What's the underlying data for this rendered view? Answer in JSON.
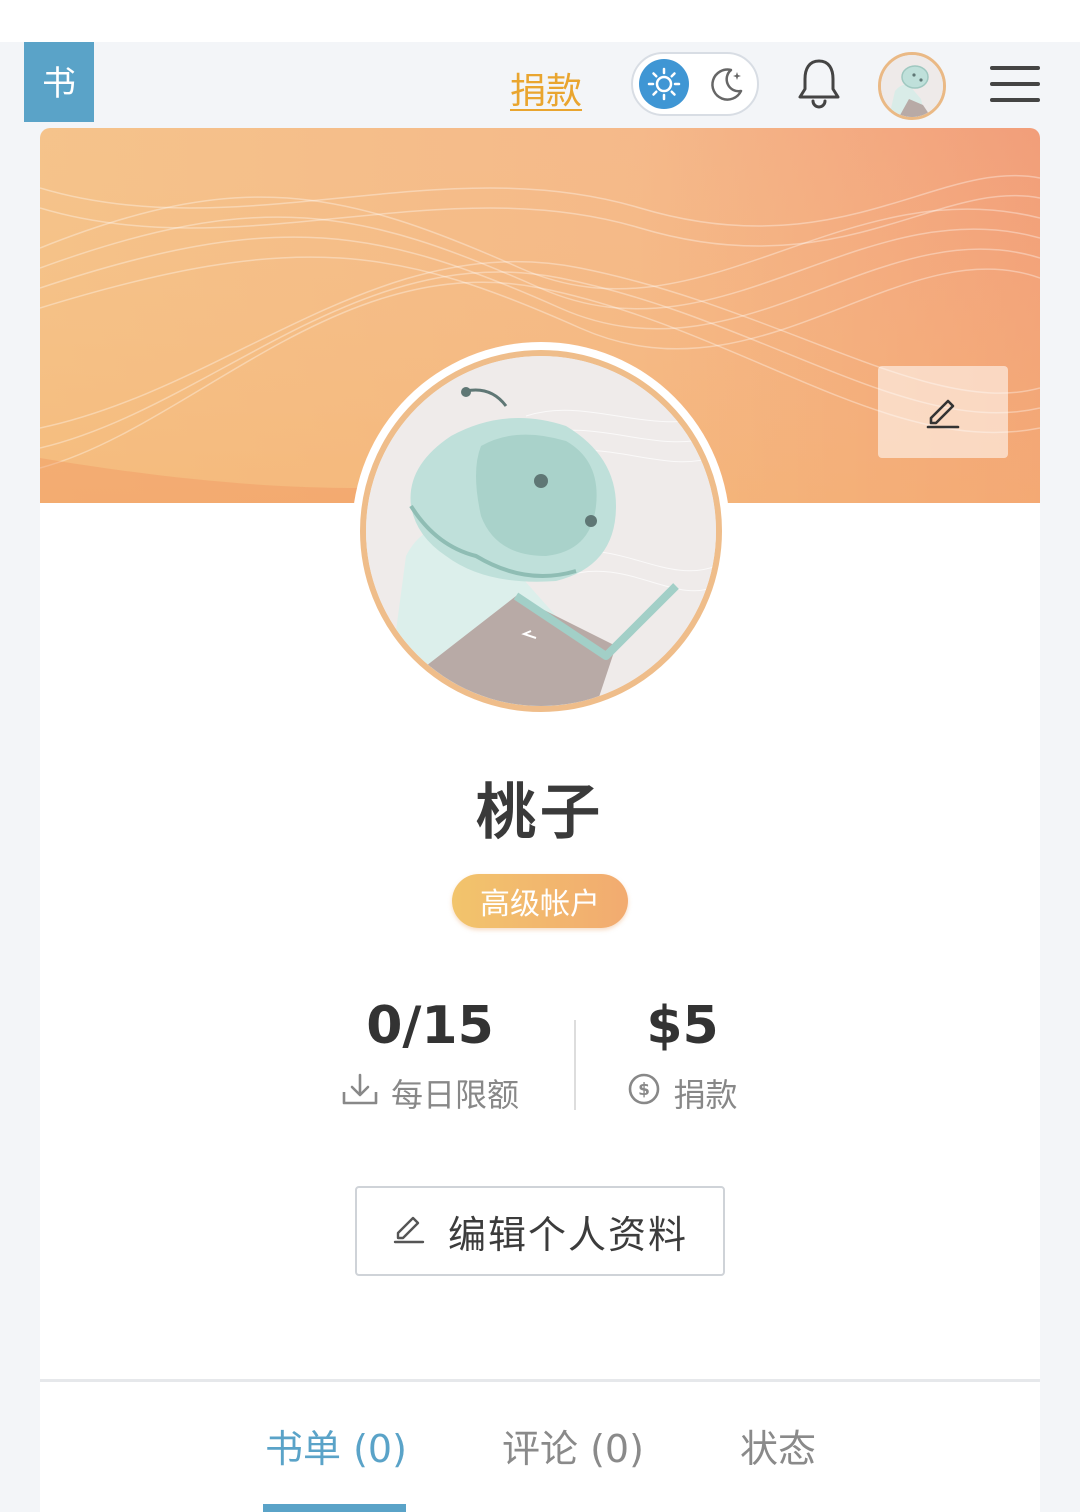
{
  "header": {
    "logo_text": "书",
    "donate_link": "捐款",
    "theme_toggle": {
      "active": "light",
      "options": [
        "sun-icon",
        "moon-icon"
      ]
    },
    "notification_icon": "bell-icon",
    "menu_icon": "hamburger-menu-icon"
  },
  "profile": {
    "name": "桃子",
    "badge": "高级帐户",
    "stats": [
      {
        "value": "0/15",
        "label": "每日限额",
        "icon": "download-icon"
      },
      {
        "value": "$5",
        "label": "捐款",
        "icon": "dollar-circle-icon"
      }
    ],
    "edit_button": "编辑个人资料",
    "cover_edit_icon": "pencil-icon"
  },
  "tabs": [
    {
      "label": "书单 (0)",
      "active": true
    },
    {
      "label": "评论 (0)",
      "active": false
    },
    {
      "label": "状态",
      "active": false
    }
  ],
  "colors": {
    "accent": "#5aa3c8",
    "donate": "#e9a52f",
    "badge_start": "#f2c46c",
    "badge_end": "#f2ab70",
    "cover_start": "#f5c38b",
    "cover_end": "#f29e7a"
  }
}
